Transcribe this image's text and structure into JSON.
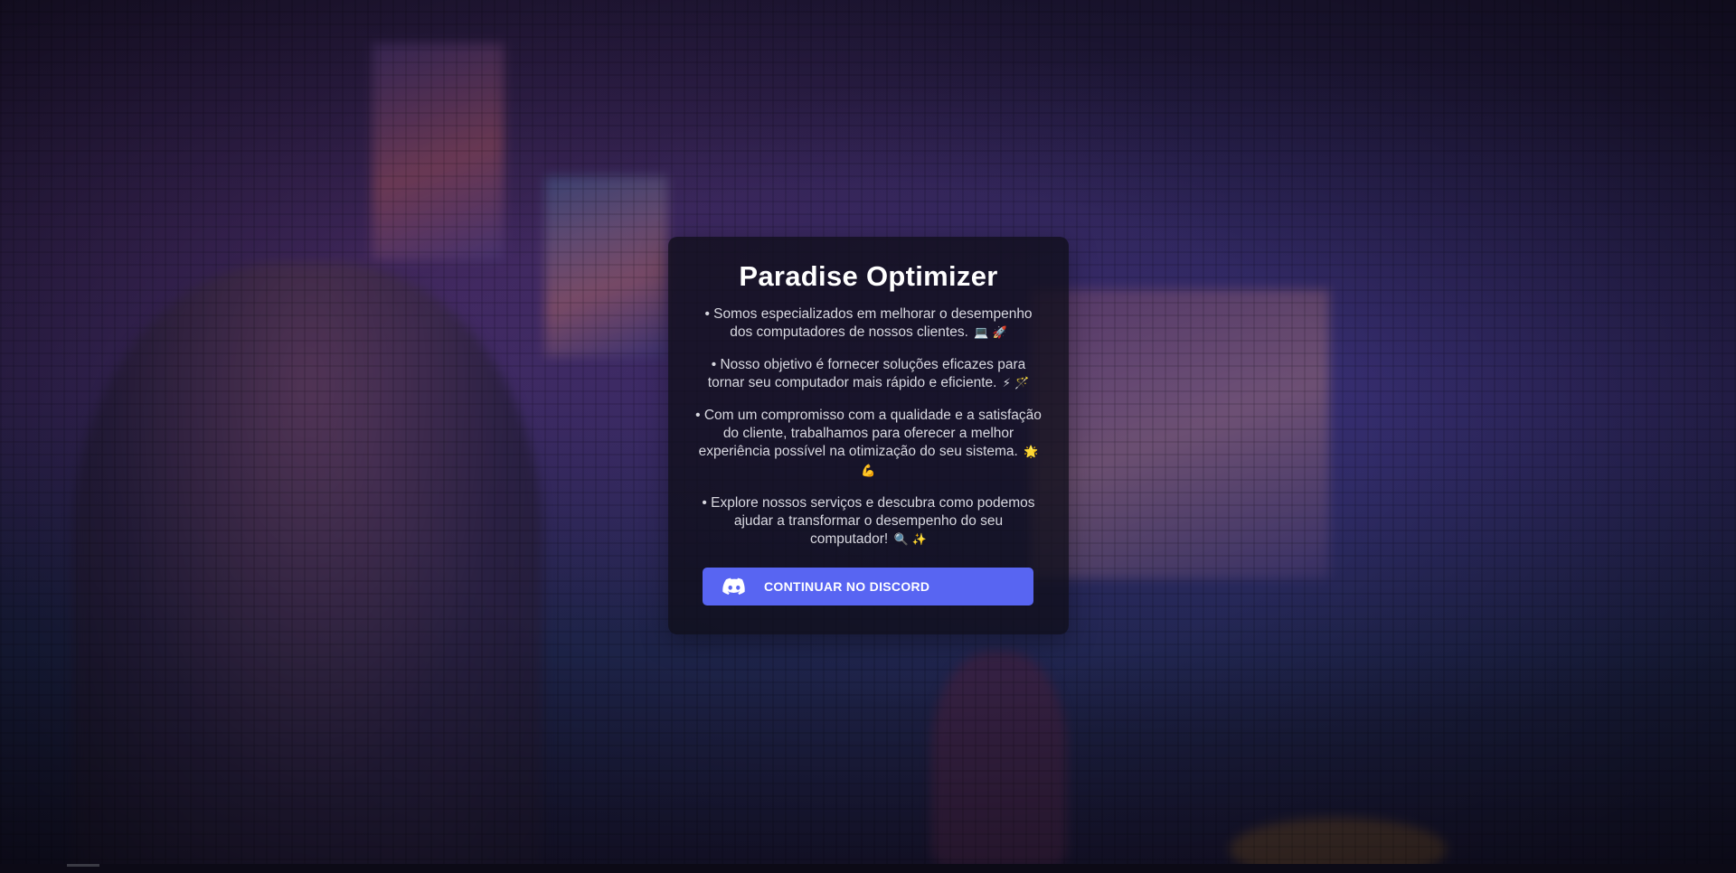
{
  "card": {
    "title": "Paradise Optimizer",
    "paragraphs": [
      {
        "text": "• Somos especializados em melhorar o desempenho dos computadores de nossos clientes.",
        "emoji": "💻 🚀"
      },
      {
        "text": "• Nosso objetivo é fornecer soluções eficazes para tornar seu computador mais rápido e eficiente.",
        "emoji": "⚡ 🪄"
      },
      {
        "text": "• Com um compromisso com a qualidade e a satisfação do cliente, trabalhamos para oferecer a melhor experiência possível na otimização do seu sistema.",
        "emoji": "🌟 💪"
      },
      {
        "text": "• Explore nossos serviços e descubra como podemos ajudar a transformar o desempenho do seu computador!",
        "emoji": "🔍 ✨"
      }
    ],
    "button": {
      "label": "CONTINUAR NO DISCORD",
      "icon": "discord-icon",
      "color": "#5865f2"
    }
  }
}
